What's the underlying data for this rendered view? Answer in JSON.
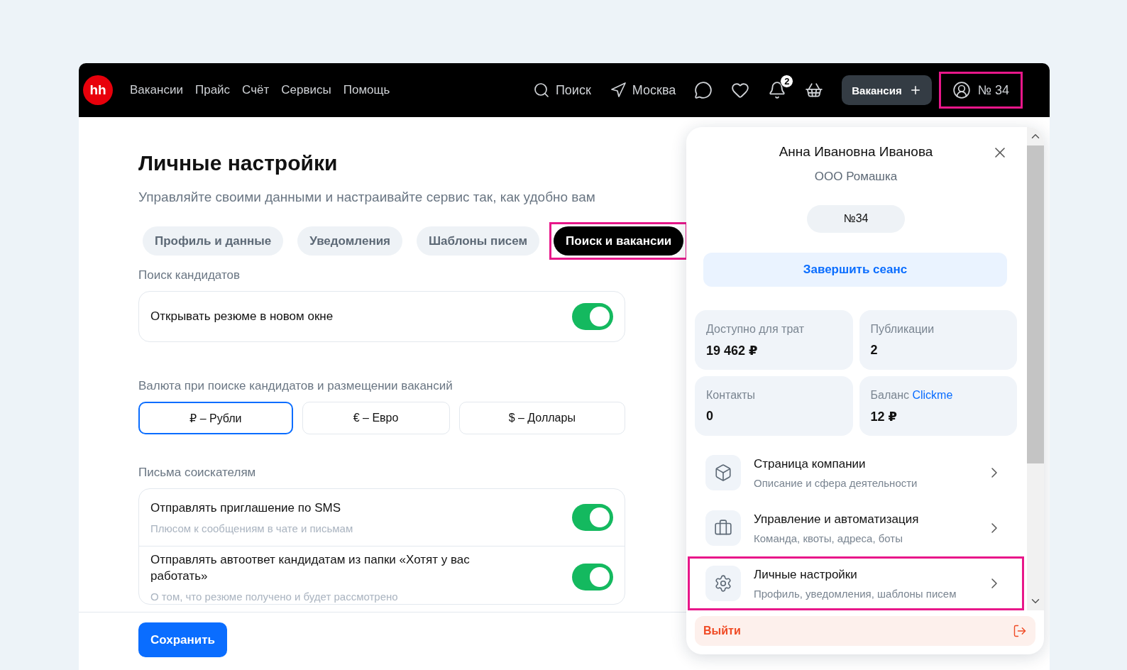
{
  "header": {
    "logo": "hh",
    "nav": [
      "Вакансии",
      "Прайс",
      "Счёт",
      "Сервисы",
      "Помощь"
    ],
    "search": "Поиск",
    "city": "Москва",
    "notifications_badge": "2",
    "vacancy_button": "Вакансия",
    "account": {
      "label": "№ 34",
      "highlighted": true
    }
  },
  "page": {
    "title": "Личные настройки",
    "subtitle": "Управляйте своими данными и настраивайте сервис так, как удобно вам",
    "tabs": [
      {
        "label": "Профиль и данные",
        "selected": false,
        "highlighted": false
      },
      {
        "label": "Уведомления",
        "selected": false,
        "highlighted": false
      },
      {
        "label": "Шаблоны писем",
        "selected": false,
        "highlighted": false
      },
      {
        "label": "Поиск и вакансии",
        "selected": true,
        "highlighted": true
      }
    ],
    "candidate_search": {
      "heading": "Поиск кандидатов",
      "settings": [
        {
          "title": "Открывать резюме в новом окне",
          "on": true
        }
      ]
    },
    "currency": {
      "heading": "Валюта при поиске кандидатов и размещении вакансий",
      "options": [
        {
          "label": "₽ – Рубли",
          "selected": true
        },
        {
          "label": "€ – Евро",
          "selected": false
        },
        {
          "label": "$ – Доллары",
          "selected": false
        }
      ]
    },
    "letters": {
      "heading": "Письма соискателям",
      "settings": [
        {
          "title": "Отправлять приглашение по SMS",
          "description": "Плюсом к сообщениям в чате и письмам",
          "on": true
        },
        {
          "title": "Отправлять автоответ кандидатам из папки «Хотят у вас работать»",
          "description": "О том, что резюме получено и будет рассмотрено",
          "on": true
        }
      ]
    },
    "save_button": "Сохранить"
  },
  "account_panel": {
    "name": "Анна Ивановна Иванова",
    "company": "ООО Ромашка",
    "number": "№34",
    "end_session": "Завершить сеанс",
    "stats": [
      {
        "label": "Доступно для трат",
        "value": "19 462 ₽"
      },
      {
        "label": "Публикации",
        "value": "2"
      },
      {
        "label": "Контакты",
        "value": "0"
      },
      {
        "label": "Баланс",
        "link": "Clickme",
        "value": "12 ₽"
      }
    ],
    "menu": [
      {
        "kind": "company",
        "title": "Страница компании",
        "description": "Описание и сфера деятельности",
        "highlighted": false
      },
      {
        "kind": "management",
        "title": "Управление и автоматизация",
        "description": "Команда, квоты, адреса, боты",
        "highlighted": false
      },
      {
        "kind": "settings",
        "title": "Личные настройки",
        "description": "Профиль, уведомления, шаблоны писем",
        "highlighted": true
      }
    ],
    "logout": "Выйти"
  }
}
